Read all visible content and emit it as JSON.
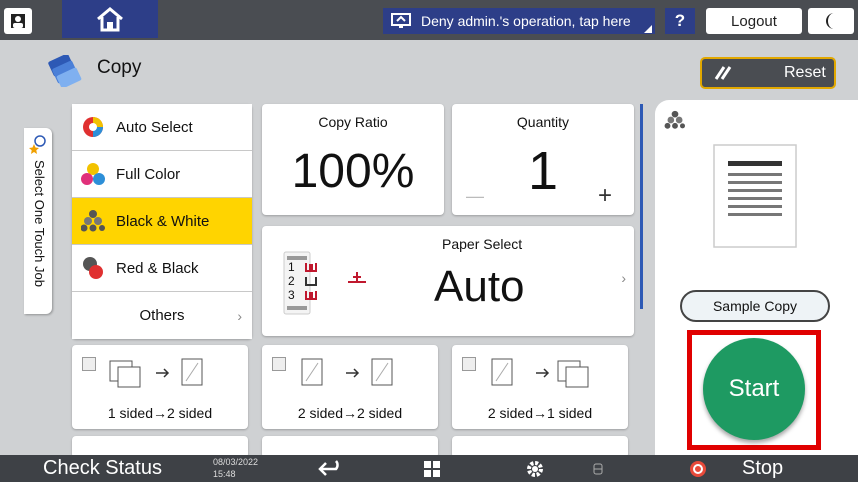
{
  "topbar": {
    "home_icon": "home-icon",
    "user_icon": "user-icon",
    "deny_label": "Deny admin.'s operation, tap here",
    "help_label": "?",
    "logout_label": "Logout",
    "night_icon": "crescent-moon-icon"
  },
  "header": {
    "title": "Copy",
    "reset_label": "Reset"
  },
  "side_tab": {
    "label": "Select One Touch Job"
  },
  "color_options": [
    {
      "label": "Auto Select",
      "selected": false
    },
    {
      "label": "Full Color",
      "selected": false
    },
    {
      "label": "Black & White",
      "selected": true
    },
    {
      "label": "Red & Black",
      "selected": false
    },
    {
      "label": "Others",
      "selected": false
    }
  ],
  "copy_ratio": {
    "label": "Copy Ratio",
    "value": "100%"
  },
  "quantity": {
    "label": "Quantity",
    "value": "1",
    "minus": "—",
    "plus": "+"
  },
  "paper_select": {
    "label": "Paper Select",
    "value": "Auto",
    "trays": [
      "1",
      "2",
      "3"
    ]
  },
  "duplex_options": [
    {
      "label": "1 sided→2 sided"
    },
    {
      "label": "2 sided→2 sided"
    },
    {
      "label": "2 sided→1 sided"
    }
  ],
  "right_panel": {
    "sample_copy_label": "Sample Copy",
    "start_label": "Start"
  },
  "bottombar": {
    "check_status": "Check Status",
    "date": "08/03/2022",
    "time": "15:48",
    "stop_label": "Stop"
  },
  "colors": {
    "selected": "#ffd400",
    "start": "#1e9a62",
    "highlight_box": "#e00000",
    "topbar": "#4a4d52"
  }
}
